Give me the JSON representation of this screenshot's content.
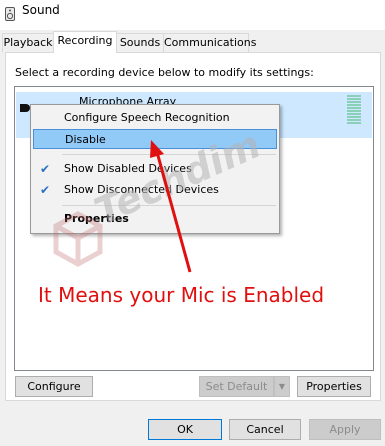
{
  "window": {
    "title": "Sound",
    "icon": "speaker-icon"
  },
  "tabs": [
    {
      "label": "Playback",
      "active": false
    },
    {
      "label": "Recording",
      "active": true
    },
    {
      "label": "Sounds",
      "active": false
    },
    {
      "label": "Communications",
      "active": false
    }
  ],
  "panel": {
    "instruction": "Select a recording device below to modify its settings:",
    "device": {
      "name": "Microphone Array",
      "icon": "microphone-icon"
    }
  },
  "context_menu": {
    "items": [
      {
        "label": "Configure Speech Recognition",
        "checked": false,
        "highlighted": false,
        "bold": false
      },
      {
        "label": "Disable",
        "checked": false,
        "highlighted": true,
        "bold": false
      },
      {
        "label": "Show Disabled Devices",
        "checked": true,
        "highlighted": false,
        "bold": false
      },
      {
        "label": "Show Disconnected Devices",
        "checked": true,
        "highlighted": false,
        "bold": false
      },
      {
        "label": "Properties",
        "checked": false,
        "highlighted": false,
        "bold": true
      }
    ]
  },
  "watermark": {
    "text": "Techdim"
  },
  "annotation": {
    "text": "It Means your Mic is Enabled",
    "color": "#e01010"
  },
  "panel_buttons": {
    "configure": "Configure",
    "set_default": "Set Default",
    "properties": "Properties"
  },
  "dialog_buttons": {
    "ok": "OK",
    "cancel": "Cancel",
    "apply": "Apply"
  },
  "colors": {
    "selection": "#cde8ff",
    "menu_highlight": "#91c9f7",
    "check": "#2c70c4",
    "level_meter": "#8ad0b8"
  }
}
